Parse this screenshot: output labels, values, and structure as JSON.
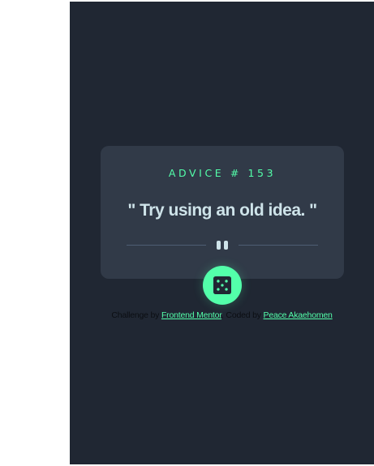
{
  "advice": {
    "heading": "ADVICE # 153",
    "text": "\" Try using an old idea. \""
  },
  "icons": {
    "divider": "pause-icon",
    "button": "dice-icon"
  },
  "attribution": {
    "prefix": "Challenge by",
    "challenge_link": "Frontend Mentor",
    "middle": ". Coded by",
    "author_link": "Peace Akaehomen"
  },
  "colors": {
    "accent": "#53ffaa",
    "background": "#202733",
    "card": "#313a48",
    "text": "#cee3e9",
    "divider": "#4f5d74"
  }
}
